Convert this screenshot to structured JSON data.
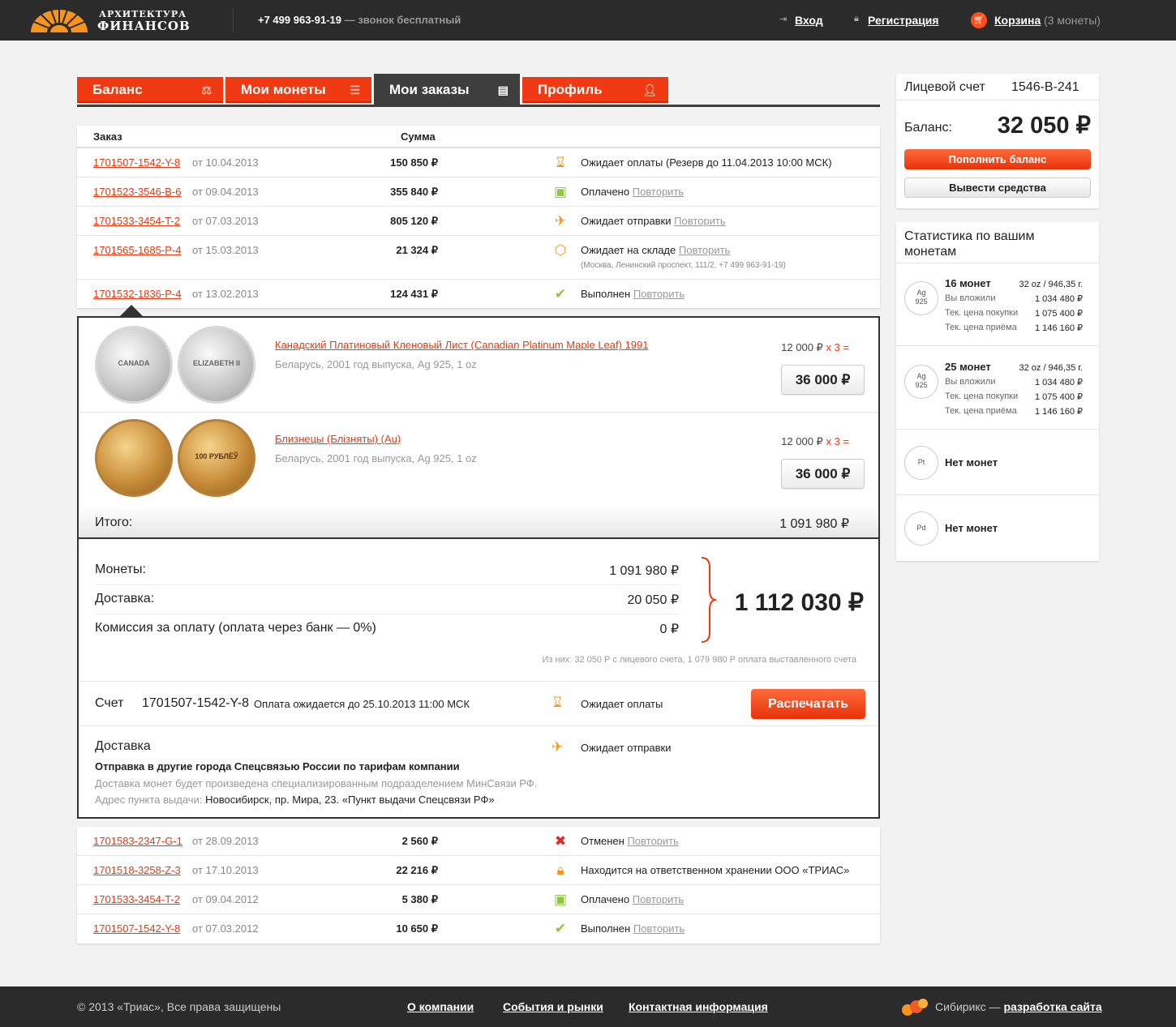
{
  "header": {
    "logo_line1": "АРХИТЕКТУРА",
    "logo_line2": "ФИНАНСОВ",
    "phone": "+7 499 963-91-19",
    "phone_note": " — звонок бесплатный",
    "login": "Вход",
    "register": "Регистрация",
    "cart": "Корзина",
    "cart_count": "(3 монеты)"
  },
  "tabs": [
    {
      "label": "Баланс",
      "icon": "scales-icon"
    },
    {
      "label": "Мои монеты",
      "icon": "coins-icon"
    },
    {
      "label": "Мои заказы",
      "icon": "list-icon"
    },
    {
      "label": "Профиль",
      "icon": "user-icon"
    }
  ],
  "table": {
    "col_order": "Заказ",
    "col_sum": "Сумма",
    "repeat": "Повторить",
    "orders_top": [
      {
        "id": "1701507-1542-Y-8",
        "date": "от 10.04.2013",
        "sum": "150 850 ₽",
        "icon": "hourglass-icon",
        "status": "Ожидает оплаты (Резерв до 11.04.2013 10:00 МСК)",
        "repeat": false
      },
      {
        "id": "1701523-3546-B-6",
        "date": "от 09.04.2013",
        "sum": "355 840 ₽",
        "icon": "wallet-icon",
        "status": "Оплачено",
        "repeat": true
      },
      {
        "id": "1701533-3454-T-2",
        "date": "от 07.03.2013",
        "sum": "805 120 ₽",
        "icon": "plane-icon",
        "status": "Ожидает отправки",
        "repeat": true
      },
      {
        "id": "1701565-1685-P-4",
        "date": "от 15.03.2013",
        "sum": "21 324 ₽",
        "icon": "box-icon",
        "status": "Ожидает на складе",
        "repeat": true,
        "sub": "(Москва, Ленинский проспект, 111/2, +7 499 963-91-19)"
      },
      {
        "id": "1701532-1836-P-4",
        "date": "от 13.02.2013",
        "sum": "124 431 ₽",
        "icon": "check-icon",
        "status": "Выполнен",
        "repeat": true
      }
    ],
    "orders_bottom": [
      {
        "id": "1701583-2347-G-1",
        "date": "от 28.09.2013",
        "sum": "2 560 ₽",
        "icon": "cross-icon",
        "status": "Отменен",
        "repeat": true
      },
      {
        "id": "1701518-3258-Z-3",
        "date": "от 17.10.2013",
        "sum": "22 216 ₽",
        "icon": "lock-icon",
        "status": "Находится на ответственном хранении ООО «ТРИАС»",
        "repeat": false
      },
      {
        "id": "1701533-3454-T-2",
        "date": "от 09.04.2012",
        "sum": "5 380 ₽",
        "icon": "wallet-icon",
        "status": "Оплачено",
        "repeat": true
      },
      {
        "id": "1701507-1542-Y-8",
        "date": "от 07.03.2012",
        "sum": "10 650 ₽",
        "icon": "check-icon",
        "status": "Выполнен",
        "repeat": true
      }
    ]
  },
  "expanded": {
    "items": [
      {
        "name": "Канадский Платиновый Кленовый Лист (Canadian Platinum Maple Leaf) 1991",
        "meta": "Беларусь, 2001 год выпуска, Ag 925, 1 oz",
        "price": "12 000 ₽",
        "mult": "х 3 =",
        "total": "36 000 ₽",
        "coin_front": "CANADA",
        "coin_back": "ELIZABETH II"
      },
      {
        "name": "Близнецы (Блізняты) (Au)",
        "meta": "Беларусь, 2001 год выпуска, Ag 925, 1 oz",
        "price": "12 000 ₽",
        "mult": "х 3 =",
        "total": "36 000 ₽",
        "coin_front": "",
        "coin_back": "100 РУБЛЁЎ"
      }
    ],
    "itogo_label": "Итого:",
    "itogo_value": "1 091 980 ₽",
    "summary": [
      {
        "label": "Монеты:",
        "value": "1 091 980 ₽"
      },
      {
        "label": "Доставка:",
        "value": "20 050 ₽"
      },
      {
        "label": "Комиссия за оплату (оплата через банк — 0%)",
        "value": "0 ₽"
      }
    ],
    "grand_total": "1 112 030 ₽",
    "split_note": "Из них: 32 050 Р с лицевого счета, 1 079 980 Р оплата выставленного счета",
    "invoice_label": "Счет",
    "invoice_id": "1701507-1542-Y-8",
    "invoice_due": "Оплата ожидается до 25.10.2013 11:00 МСК",
    "invoice_status": "Ожидает оплаты",
    "print": "Распечатать",
    "delivery_title": "Доставка",
    "delivery_status": "Ожидает отправки",
    "delivery_method": "Отправка в другие города Спецсвязью России по тарифам компании",
    "delivery_note": "Доставка монет будет произведена специализированным подразделением МинСвязи РФ.",
    "delivery_addr_label": "Адрес пункта выдачи:",
    "delivery_addr": "Новосибирск, пр. Мира, 23. «Пункт выдачи Спецсвязи РФ»"
  },
  "account": {
    "label": "Лицевой счет",
    "number": "1546-B-241",
    "balance_label": "Баланс:",
    "balance": "32 050 ₽",
    "topup": "Пополнить баланс",
    "withdraw": "Вывести средства"
  },
  "stats": {
    "title": "Статистика по вашим монетам",
    "items": [
      {
        "metal": "Ag",
        "fine": "925",
        "count": "16 монет",
        "weight": "32 oz / 946,35 г.",
        "rows": [
          [
            "Вы вложили",
            "1 034 480 ₽"
          ],
          [
            "Тек. цена покупки",
            "1 075 400 ₽"
          ],
          [
            "Тек. цена приёма",
            "1 146 160 ₽"
          ]
        ]
      },
      {
        "metal": "Ag",
        "fine": "925",
        "count": "25 монет",
        "weight": "32 oz / 946,35 г.",
        "rows": [
          [
            "Вы вложили",
            "1 034 480 ₽"
          ],
          [
            "Тек. цена покупки",
            "1 075 400 ₽"
          ],
          [
            "Тек. цена приёма",
            "1 146 160 ₽"
          ]
        ]
      },
      {
        "metal": "Pt",
        "fine": "",
        "count": "Нет монет"
      },
      {
        "metal": "Pd",
        "fine": "",
        "count": "Нет монет"
      }
    ]
  },
  "footer": {
    "copyright": "© 2013 «Триас», Все права защищены",
    "links": [
      "О компании",
      "События и рынки",
      "Контактная информация"
    ],
    "dev_prefix": "Сибирикс — ",
    "dev_link": "разработка сайта"
  },
  "colors": {
    "accent": "#f03a13",
    "dark": "#2b2b2b",
    "link": "#e33b12",
    "ok": "#8cc63f",
    "warn": "#f7941d"
  }
}
